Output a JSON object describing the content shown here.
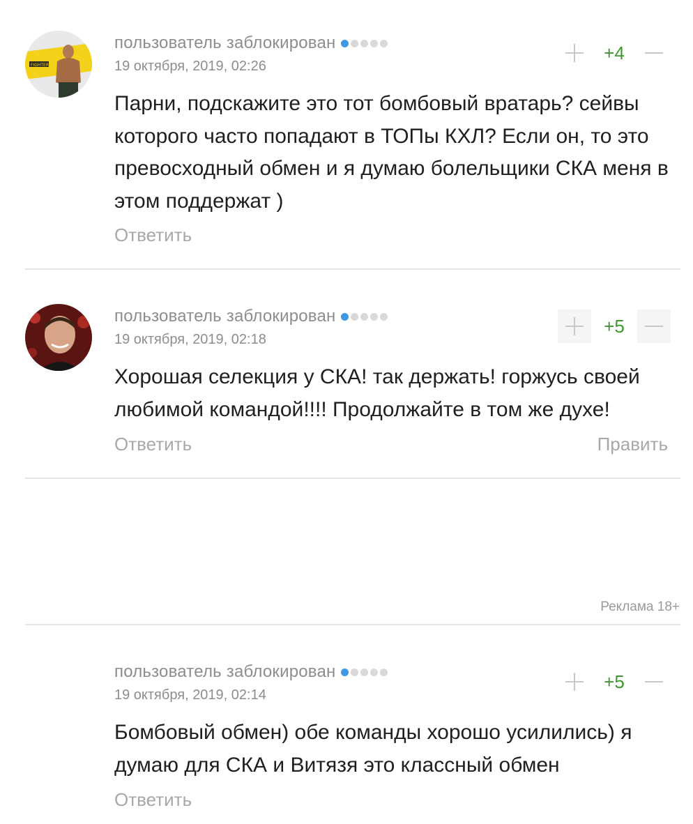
{
  "comments": [
    {
      "author": "пользователь заблокирован",
      "date": "19 октября, 2019, 02:26",
      "score": "+4",
      "text": "Парни, подскажите это тот бомбовый вратарь? сейвы которого часто попадают в ТОПы КХЛ? Если он, то это превосходный обмен и я думаю болельщики СКА меня в этом поддержат )",
      "reply_label": "Ответить",
      "avatar_text": "FIGHTER"
    },
    {
      "author": "пользователь заблокирован",
      "date": "19 октября, 2019, 02:18",
      "score": "+5",
      "text": "Хорошая селекция у СКА! так держать! горжусь своей любимой командой!!!! Продолжайте в том же духе!",
      "reply_label": "Ответить",
      "edit_label": "Править"
    },
    {
      "author": "пользователь заблокирован",
      "date": "19 октября, 2019, 02:14",
      "score": "+5",
      "text": "Бомбовый обмен) обе команды хорошо усилились) я думаю для СКА и Витязя это классный обмен",
      "reply_label": "Ответить"
    }
  ],
  "ad": {
    "label": "Реклама 18+"
  },
  "rating_dots": {
    "filled": 1,
    "total": 5
  },
  "colors": {
    "score": "#3e9a2e",
    "dot_active": "#3d98e6",
    "muted": "#8d8d8d"
  }
}
